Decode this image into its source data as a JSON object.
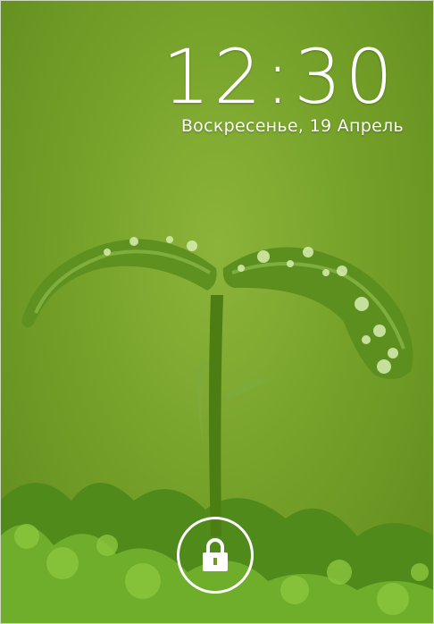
{
  "lockscreen": {
    "time": "12:30",
    "date": "Воскресенье, 19 Апрель",
    "unlock_icon": "lock-icon",
    "accent_color": "#ffffff",
    "wallpaper_color": "#76a22a"
  }
}
